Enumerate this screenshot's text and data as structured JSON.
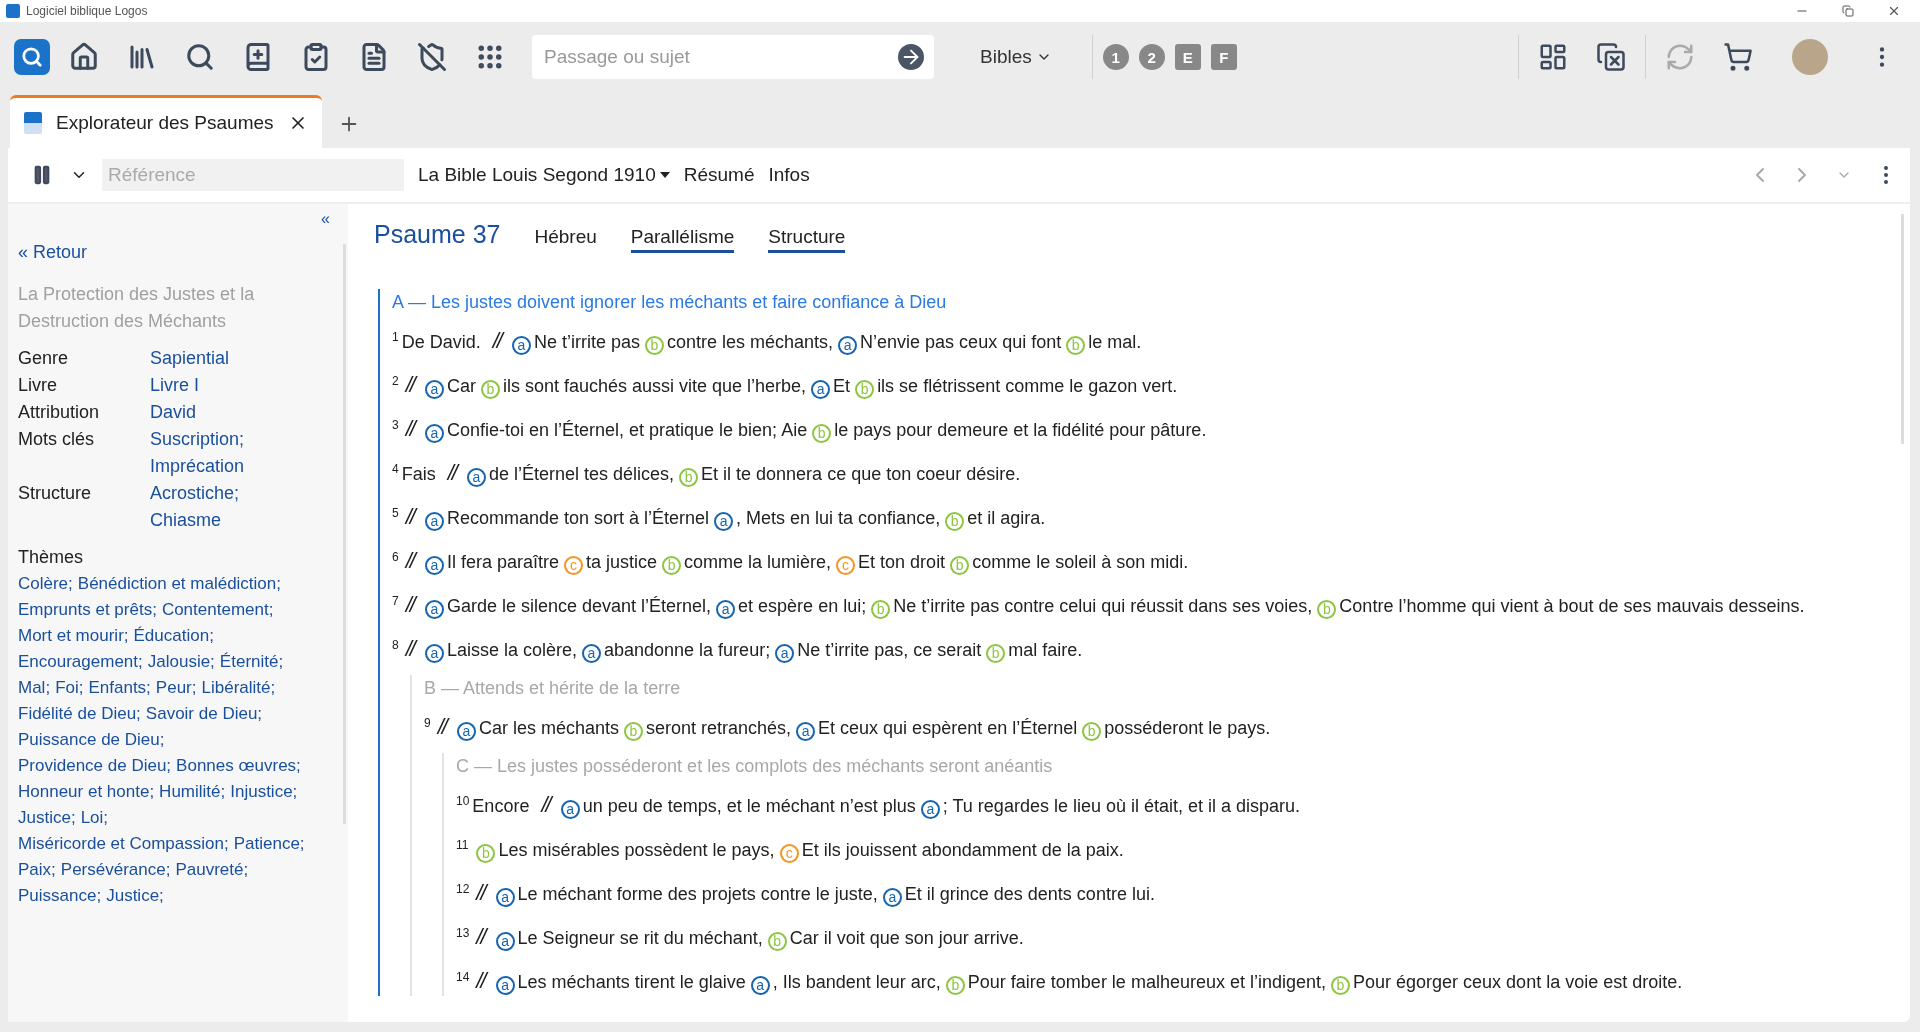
{
  "window": {
    "title": "Logiciel biblique Logos"
  },
  "toolbar": {
    "search": {
      "placeholder": "Passage ou sujet"
    },
    "bibles_menu": "Bibles",
    "resource_buttons": [
      {
        "label": "1",
        "kind": "circle"
      },
      {
        "label": "2",
        "kind": "circle"
      },
      {
        "label": "E",
        "kind": "square"
      },
      {
        "label": "F",
        "kind": "square"
      }
    ]
  },
  "tabs": [
    {
      "label": "Explorateur des Psaumes",
      "selected": true
    }
  ],
  "panel_toolbar": {
    "reference": {
      "placeholder": "Référence"
    },
    "version": "La Bible Louis Segond 1910",
    "links": [
      "Résumé",
      "Infos"
    ]
  },
  "sidebar": {
    "back": "« Retour",
    "collapse": "«",
    "title": "La Protection des Justes et la Destruction des Méchants",
    "facts": [
      {
        "label": "Genre",
        "values": [
          "Sapiential"
        ]
      },
      {
        "label": "Livre",
        "values": [
          "Livre I"
        ]
      },
      {
        "label": "Attribution",
        "values": [
          "David"
        ]
      },
      {
        "label": "Mots clés",
        "values": [
          "Suscription;",
          "Imprécation"
        ]
      },
      {
        "label": "Structure",
        "values": [
          "Acrostiche;",
          "Chiasme"
        ]
      }
    ],
    "themes_label": "Thèmes",
    "themes": [
      "Colère;",
      "Bénédiction et malédiction;",
      "Emprunts et prêts;",
      "Contentement;",
      "Mort et mourir;",
      "Éducation;",
      "Encouragement;",
      "Jalousie;",
      "Éternité;",
      "Mal;",
      "Foi;",
      "Enfants;",
      "Peur;",
      "Libéralité;",
      "Fidélité de Dieu;",
      "Savoir de Dieu;",
      "Puissance de Dieu;",
      "Providence de Dieu;",
      "Bonnes œuvres;",
      "Honneur et honte;",
      "Humilité;",
      "Injustice;",
      "Justice;",
      "Loi;",
      "Miséricorde et Compassion;",
      "Patience;",
      "Paix;",
      "Persévérance;",
      "Pauvreté;",
      "Puissance;",
      "Justice;"
    ]
  },
  "psalm": {
    "title": "Psaume 37",
    "views": [
      {
        "label": "Hébreu",
        "on": false
      },
      {
        "label": "Parallélisme",
        "on": true
      },
      {
        "label": "Structure",
        "on": true
      }
    ],
    "sections": [
      {
        "heading": "A — Les justes doivent ignorer les méchants et faire confiance à Dieu",
        "highlighted": true,
        "verses": [
          {
            "number": "1",
            "lead": "De David.",
            "parallel": "//",
            "segments": [
              {
                "letter": "a",
                "color": "#1565b0",
                "text": "Ne t’irrite pas"
              },
              {
                "letter": "b",
                "color": "#8cc63f",
                "text": "contre les méchants,"
              },
              {
                "letter": "a",
                "color": "#1565b0",
                "text": "N’envie pas ceux qui font"
              },
              {
                "letter": "b",
                "color": "#8cc63f",
                "text": "le mal."
              }
            ]
          },
          {
            "number": "2",
            "parallel": "//",
            "segments": [
              {
                "letter": "a",
                "color": "#1565b0",
                "text": "Car"
              },
              {
                "letter": "b",
                "color": "#8cc63f",
                "text": "ils sont fauchés aussi vite que l’herbe,"
              },
              {
                "letter": "a",
                "color": "#1565b0",
                "text": "Et"
              },
              {
                "letter": "b",
                "color": "#8cc63f",
                "text": "ils se flétrissent comme le gazon vert."
              }
            ]
          },
          {
            "number": "3",
            "parallel": "//",
            "segments": [
              {
                "letter": "a",
                "color": "#1565b0",
                "text": "Confie-toi en l’Éternel, et pratique le bien; Aie"
              },
              {
                "letter": "b",
                "color": "#8cc63f",
                "text": "le pays pour demeure et la fidélité pour pâture."
              }
            ]
          },
          {
            "number": "4",
            "lead": "Fais",
            "parallel": "//",
            "segments": [
              {
                "letter": "a",
                "color": "#1565b0",
                "text": "de l’Éternel tes délices,"
              },
              {
                "letter": "b",
                "color": "#8cc63f",
                "text": "Et il te donnera ce que ton coeur désire."
              }
            ]
          },
          {
            "number": "5",
            "parallel": "//",
            "segments": [
              {
                "letter": "a",
                "color": "#1565b0",
                "text": "Recommande ton sort à l’Éternel"
              },
              {
                "letter": "a",
                "color": "#1565b0",
                "text": ", Mets en lui ta confiance,"
              },
              {
                "letter": "b",
                "color": "#8cc63f",
                "text": "et il agira."
              }
            ]
          },
          {
            "number": "6",
            "parallel": "//",
            "segments": [
              {
                "letter": "a",
                "color": "#1565b0",
                "text": "Il fera paraître"
              },
              {
                "letter": "c",
                "color": "#f7941d",
                "text": "ta justice"
              },
              {
                "letter": "b",
                "color": "#8cc63f",
                "text": "comme la lumière,"
              },
              {
                "letter": "c",
                "color": "#f7941d",
                "text": "Et ton droit"
              },
              {
                "letter": "b",
                "color": "#8cc63f",
                "text": "comme le soleil à son midi."
              }
            ]
          },
          {
            "number": "7",
            "parallel": "//",
            "segments": [
              {
                "letter": "a",
                "color": "#1565b0",
                "text": "Garde le silence devant l’Éternel,"
              },
              {
                "letter": "a",
                "color": "#1565b0",
                "text": "et espère en lui;"
              },
              {
                "letter": "b",
                "color": "#8cc63f",
                "text": "Ne t’irrite pas contre celui qui réussit dans ses voies,"
              },
              {
                "letter": "b",
                "color": "#8cc63f",
                "text": "Contre l’homme qui vient à bout de ses mauvais desseins."
              }
            ]
          },
          {
            "number": "8",
            "parallel": "//",
            "segments": [
              {
                "letter": "a",
                "color": "#1565b0",
                "text": "Laisse la colère,"
              },
              {
                "letter": "a",
                "color": "#1565b0",
                "text": "abandonne la fureur;"
              },
              {
                "letter": "a",
                "color": "#1565b0",
                "text": "Ne t’irrite pas, ce serait"
              },
              {
                "letter": "b",
                "color": "#8cc63f",
                "text": "mal faire."
              }
            ]
          }
        ],
        "children": [
          {
            "heading": "B — Attends et hérite de la terre",
            "highlighted": false,
            "verses": [
              {
                "number": "9",
                "parallel": "//",
                "segments": [
                  {
                    "letter": "a",
                    "color": "#1565b0",
                    "text": "Car les méchants"
                  },
                  {
                    "letter": "b",
                    "color": "#8cc63f",
                    "text": "seront retranchés,"
                  },
                  {
                    "letter": "a",
                    "color": "#1565b0",
                    "text": "Et ceux qui espèrent en l’Éternel"
                  },
                  {
                    "letter": "b",
                    "color": "#8cc63f",
                    "text": "posséderont le pays."
                  }
                ]
              }
            ],
            "children": [
              {
                "heading": "C — Les justes posséderont et les complots des méchants seront anéantis",
                "highlighted": false,
                "verses": [
                  {
                    "number": "10",
                    "lead": "Encore",
                    "parallel": "//",
                    "segments": [
                      {
                        "letter": "a",
                        "color": "#1565b0",
                        "text": "un peu de temps, et le méchant n’est plus"
                      },
                      {
                        "letter": "a",
                        "color": "#1565b0",
                        "text": "; Tu regardes le lieu où il était, et il a disparu."
                      }
                    ]
                  },
                  {
                    "number": "11",
                    "segments": [
                      {
                        "letter": "b",
                        "color": "#8cc63f",
                        "text": "Les misérables possèdent le pays,"
                      },
                      {
                        "letter": "c",
                        "color": "#f7941d",
                        "text": "Et ils jouissent abondamment de la paix."
                      }
                    ]
                  },
                  {
                    "number": "12",
                    "parallel": "//",
                    "segments": [
                      {
                        "letter": "a",
                        "color": "#1565b0",
                        "text": "Le méchant forme des projets contre le juste,"
                      },
                      {
                        "letter": "a",
                        "color": "#1565b0",
                        "text": "Et il grince des dents contre lui."
                      }
                    ]
                  },
                  {
                    "number": "13",
                    "parallel": "//",
                    "segments": [
                      {
                        "letter": "a",
                        "color": "#1565b0",
                        "text": "Le Seigneur se rit du méchant,"
                      },
                      {
                        "letter": "b",
                        "color": "#8cc63f",
                        "text": "Car il voit que son jour arrive."
                      }
                    ]
                  },
                  {
                    "number": "14",
                    "parallel": "//",
                    "segments": [
                      {
                        "letter": "a",
                        "color": "#1565b0",
                        "text": "Les méchants tirent le glaive"
                      },
                      {
                        "letter": "a",
                        "color": "#1565b0",
                        "text": ", Ils bandent leur arc,"
                      },
                      {
                        "letter": "b",
                        "color": "#8cc63f",
                        "text": "Pour faire tomber le malheureux et l’indigent,"
                      },
                      {
                        "letter": "b",
                        "color": "#8cc63f",
                        "text": "Pour égorger ceux dont la voie est droite."
                      }
                    ]
                  }
                ]
              }
            ]
          }
        ]
      }
    ]
  }
}
